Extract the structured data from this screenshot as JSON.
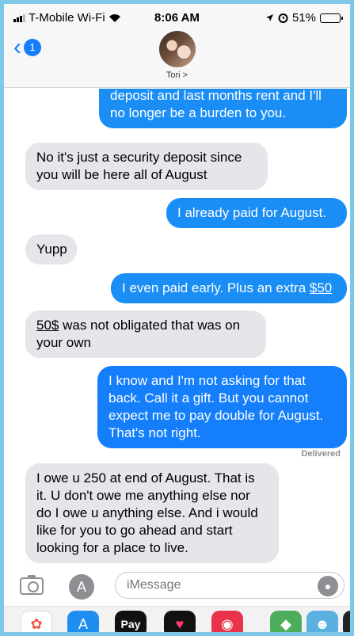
{
  "status_bar": {
    "carrier": "T-Mobile Wi-Fi",
    "time": "8:06 AM",
    "battery": "51%",
    "battery_level": 0.51
  },
  "header": {
    "back_badge": "1",
    "contact_name": "Tori >"
  },
  "messages": [
    {
      "type": "sent",
      "text": "deposit and last months rent and I'll no longer be a burden to you."
    },
    {
      "type": "received",
      "text": "No it's just a security deposit since you will be here all of August"
    },
    {
      "type": "sent",
      "text": "I already paid for August."
    },
    {
      "type": "received",
      "text": "Yupp"
    },
    {
      "type": "sent",
      "text_before": "I even paid early. Plus an extra ",
      "link": "$50"
    },
    {
      "type": "received",
      "link": "50$",
      "text_after": " was not obligated that was on your own"
    },
    {
      "type": "sent",
      "text": "I know and I'm not asking for that back. Call it a gift. But you cannot expect me to pay double for August. That's not right."
    },
    {
      "type": "received",
      "text": "I owe u 250 at end of August. That is it. U don't owe me anything else nor do I owe u anything else. And i would like for you to go ahead and start looking for a place to live."
    }
  ],
  "delivered_label": "Delivered",
  "input": {
    "placeholder": "iMessage"
  },
  "app_drawer": {
    "pay_label": "Pay"
  },
  "colors": {
    "sent_bubble": "#1b8ef5",
    "received_bubble": "#e5e5ea",
    "accent": "#147efb"
  }
}
